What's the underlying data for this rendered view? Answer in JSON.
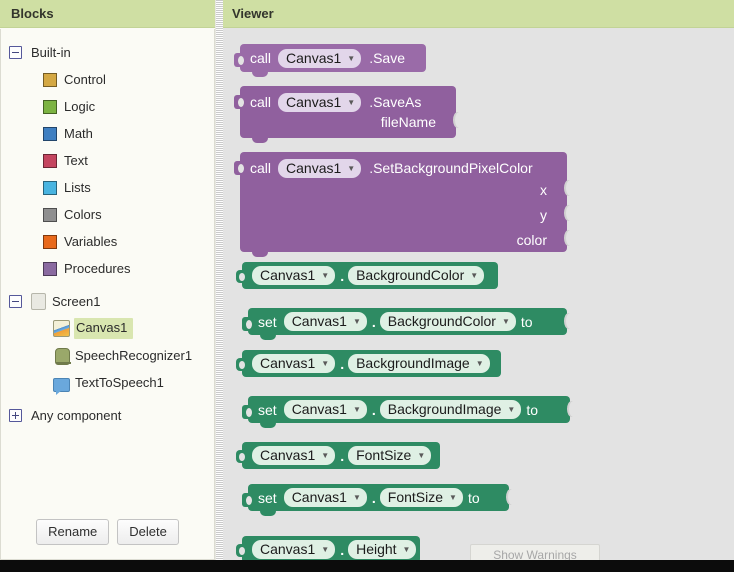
{
  "panels": {
    "blocks_title": "Blocks",
    "viewer_title": "Viewer"
  },
  "sidebar": {
    "builtin": {
      "label": "Built-in",
      "toggle_icon": "minus-square-icon",
      "items": [
        {
          "label": "Control",
          "color": "#d4a843",
          "icon": "color-swatch-icon"
        },
        {
          "label": "Logic",
          "color": "#7cb342",
          "icon": "color-swatch-icon"
        },
        {
          "label": "Math",
          "color": "#3f7fc1",
          "icon": "color-swatch-icon"
        },
        {
          "label": "Text",
          "color": "#c4455f",
          "icon": "color-swatch-icon"
        },
        {
          "label": "Lists",
          "color": "#49b4e0",
          "icon": "color-swatch-icon"
        },
        {
          "label": "Colors",
          "color": "#8f8f8f",
          "icon": "color-swatch-icon"
        },
        {
          "label": "Variables",
          "color": "#e8691b",
          "icon": "color-swatch-icon"
        },
        {
          "label": "Procedures",
          "color": "#8a6aa0",
          "icon": "color-swatch-icon"
        }
      ]
    },
    "screen": {
      "label": "Screen1",
      "toggle_icon": "minus-square-icon",
      "icon": "screen-icon",
      "children": [
        {
          "label": "Canvas1",
          "icon": "canvas-icon",
          "selected": true
        },
        {
          "label": "SpeechRecognizer1",
          "icon": "microphone-icon",
          "selected": false
        },
        {
          "label": "TextToSpeech1",
          "icon": "speech-bubble-icon",
          "selected": false
        }
      ]
    },
    "any_component": {
      "label": "Any component",
      "toggle_icon": "plus-square-icon"
    },
    "buttons": {
      "rename": "Rename",
      "delete": "Delete"
    }
  },
  "viewer": {
    "show_warnings_label": "Show Warnings",
    "blocks": [
      {
        "id": "call-canvas1-save",
        "kind": "call",
        "call_label": "call",
        "component": "Canvas1",
        "method": ".Save",
        "color": "#9a6ba8",
        "args": []
      },
      {
        "id": "call-canvas1-saveas",
        "kind": "call",
        "call_label": "call",
        "component": "Canvas1",
        "method": ".SaveAs",
        "color": "#90609e",
        "args": [
          "fileName"
        ]
      },
      {
        "id": "call-canvas1-setbackgroundpixelcolor",
        "kind": "call",
        "call_label": "call",
        "component": "Canvas1",
        "method": ".SetBackgroundPixelColor",
        "color": "#90609e",
        "args": [
          "x",
          "y",
          "color"
        ]
      },
      {
        "id": "get-canvas1-backgroundcolor",
        "kind": "getter",
        "component": "Canvas1",
        "property": "BackgroundColor",
        "color": "#2e8b63"
      },
      {
        "id": "set-canvas1-backgroundcolor",
        "kind": "setter",
        "set_label": "set",
        "component": "Canvas1",
        "property": "BackgroundColor",
        "to_label": "to",
        "color": "#2e8b63"
      },
      {
        "id": "get-canvas1-backgroundimage",
        "kind": "getter",
        "component": "Canvas1",
        "property": "BackgroundImage",
        "color": "#2e8b63"
      },
      {
        "id": "set-canvas1-backgroundimage",
        "kind": "setter",
        "set_label": "set",
        "component": "Canvas1",
        "property": "BackgroundImage",
        "to_label": "to",
        "color": "#2e8b63"
      },
      {
        "id": "get-canvas1-fontsize",
        "kind": "getter",
        "component": "Canvas1",
        "property": "FontSize",
        "color": "#2e8b63"
      },
      {
        "id": "set-canvas1-fontsize",
        "kind": "setter",
        "set_label": "set",
        "component": "Canvas1",
        "property": "FontSize",
        "to_label": "to",
        "color": "#2e8b63"
      },
      {
        "id": "get-canvas1-height",
        "kind": "getter",
        "component": "Canvas1",
        "property": "Height",
        "color": "#2e8b63"
      }
    ]
  }
}
